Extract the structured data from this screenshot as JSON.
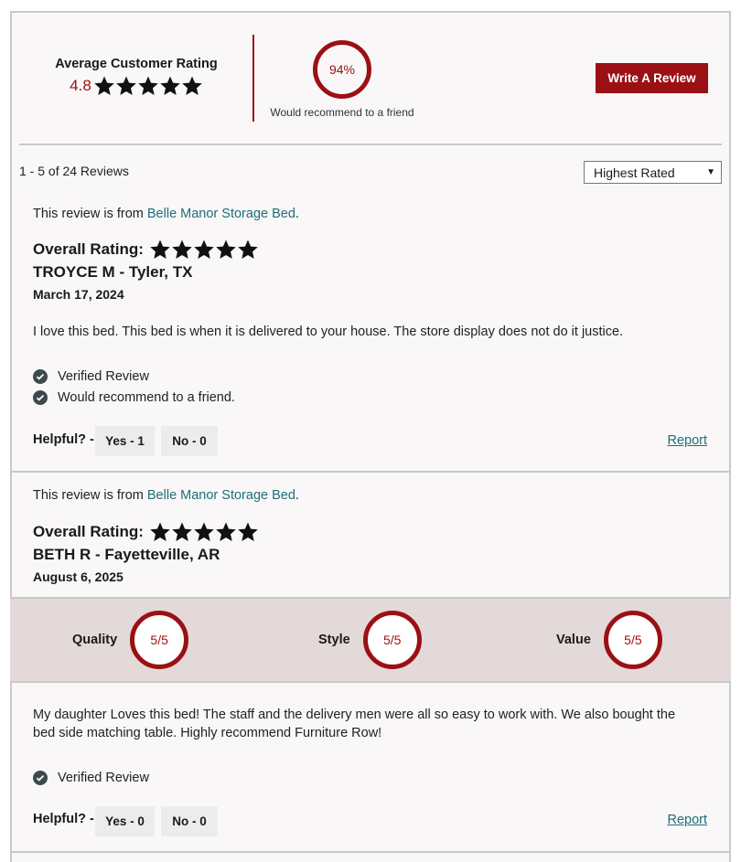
{
  "summary": {
    "avg_label": "Average Customer Rating",
    "avg_value": "4.8",
    "recommend_percent": "94%",
    "recommend_label": "Would recommend to a friend",
    "write_review": "Write A Review"
  },
  "list": {
    "count": "1 - 5 of 24 Reviews",
    "sort_selected": "Highest Rated"
  },
  "reviews": [
    {
      "from_prefix": "This review is from ",
      "product": "Belle Manor Storage Bed",
      "from_suffix": ".",
      "overall_label": "Overall Rating:",
      "stars": 5,
      "author": "TROYCE M - Tyler, TX",
      "date": "March 17, 2024",
      "text": "I love this bed. This bed is when it is delivered to your house. The store display does not do it justice.",
      "verified": "Verified Review",
      "recommend": "Would recommend to a friend.",
      "helpful_label": "Helpful? -",
      "yes_label": "Yes - 1",
      "no_label": "No - 0",
      "report": "Report"
    },
    {
      "from_prefix": "This review is from ",
      "product": "Belle Manor Storage Bed",
      "from_suffix": ".",
      "overall_label": "Overall Rating:",
      "stars": 5,
      "author": "BETH R - Fayetteville, AR",
      "date": "August 6, 2025",
      "ratings": [
        {
          "label": "Quality",
          "value": "5/5"
        },
        {
          "label": "Style",
          "value": "5/5"
        },
        {
          "label": "Value",
          "value": "5/5"
        }
      ],
      "text": "My daughter Loves this bed! The staff and the delivery men were all so easy to work with. We also bought the bed side matching table. Highly recommend Furniture Row!",
      "verified": "Verified Review",
      "helpful_label": "Helpful? -",
      "yes_label": "Yes - 0",
      "no_label": "No - 0",
      "report": "Report"
    }
  ],
  "colors": {
    "accent": "#9b1015",
    "link": "#1f6e7a",
    "band": "#e3d9d8"
  }
}
